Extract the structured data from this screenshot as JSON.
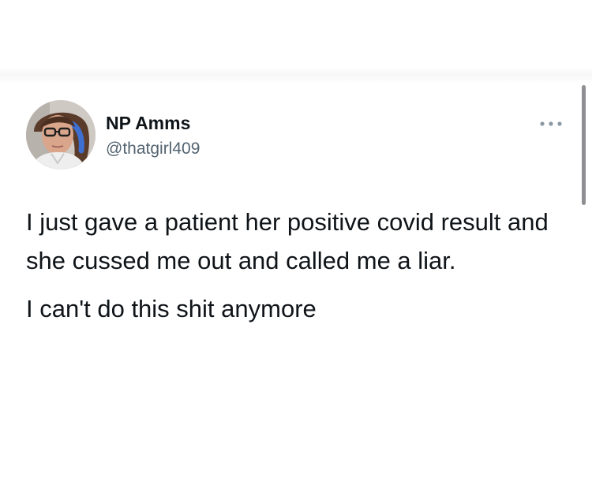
{
  "tweet": {
    "author": {
      "display_name": "NP Amms",
      "handle": "@thatgirl409"
    },
    "paragraphs": [
      "I just gave a patient her positive covid result and she cussed me out and called me a liar.",
      "I can't do this shit anymore"
    ],
    "more_icon": "ellipsis-icon"
  },
  "colors": {
    "text_primary": "#0f1419",
    "text_secondary": "#536471",
    "background": "#ffffff",
    "scrollbar": "#8e8e93"
  }
}
